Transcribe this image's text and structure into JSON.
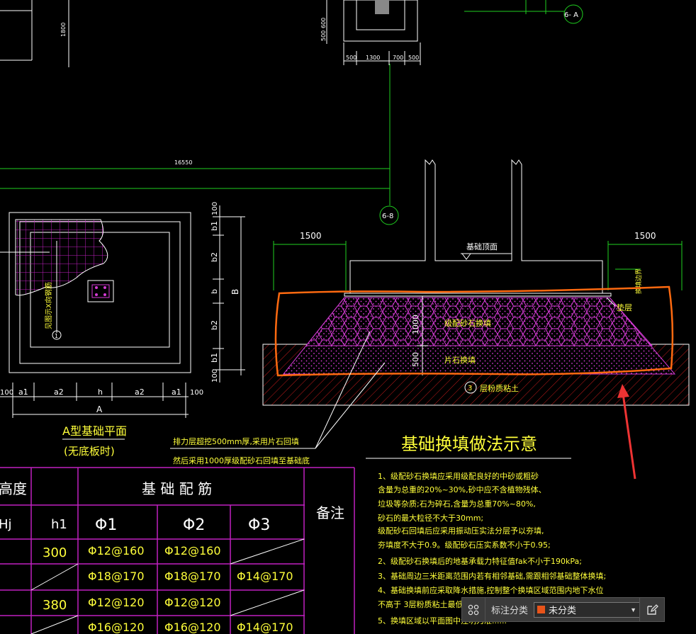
{
  "drawing": {
    "grid_labels": {
      "axis_6a": "6- A",
      "axis_6b": "6-8"
    },
    "dims_top": [
      "500",
      "1300",
      "700",
      "500"
    ],
    "dims_top_vertical": [
      "500",
      "600",
      "1800"
    ],
    "dim_long": "16550",
    "plan": {
      "title": "A型基础平面",
      "subtitle": "(无底板时)",
      "label_vert": "见图示X向钢筋",
      "label_num": "1",
      "dims_bottom": [
        "100",
        "a1",
        "a2",
        "h",
        "a2",
        "a1",
        "100"
      ],
      "dim_bottom_total": "A",
      "dims_right": [
        "100",
        "b1",
        "b2",
        "b",
        "b2",
        "b1",
        "100"
      ],
      "dim_right_total": "B"
    },
    "section": {
      "dim_left": "1500",
      "dim_right": "1500",
      "label_top": "基础顶面",
      "label_gravel": "级配砂石换填",
      "label_rubble": "片石换填",
      "label_cushion": "垫层",
      "label_soil_circle": "3",
      "label_soil": "层粉质粘土",
      "label_side": "换填边界",
      "dim_1000": "1000",
      "dim_500": "500",
      "title": "基础换填做法示意"
    },
    "note_1": "排力层超挖500mm厚,采用片石回填",
    "note_2": "然后采用1000厚级配砂石回填至基础底",
    "spec_lines": [
      "1、级配砂石换填应采用级配良好的中砂或粗砂",
      "含量为总重的20%~30%,砂中应不含植物残体、",
      "垃圾等杂质;石为碎石,含量为总重70%~80%,",
      "砂石的最大粒径不大于30mm;",
      "级配砂石回填后应采用振动压实法分层予以夯填,",
      "夯填度不大于0.9。级配砂石压实系数不小于0.95;",
      "2、级配砂石换填后的地基承载力特征值fak不小于190kPa;",
      "3、基础周边三米距离范围内若有相邻基础,需跟相邻基础整体换填;",
      "4、基础换填前应采取降水措施,控制整个换填区域范围内地下水位",
      "不高于 3层粉质粘土最低...",
      "5、换填区域以平面图中注明为准......"
    ],
    "table": {
      "header_col0": "高度",
      "header_group": "基 础 配 筋",
      "header_note": "备注",
      "sub_headers": [
        "Hj",
        "h1",
        "Φ1",
        "Φ2",
        "Φ3"
      ],
      "rows": [
        {
          "h1": "300",
          "c1": "Φ12@160",
          "c2": "Φ12@160",
          "c3": ""
        },
        {
          "h1": "",
          "c1": "Φ18@170",
          "c2": "Φ18@170",
          "c3": "Φ14@170"
        },
        {
          "h1": "380",
          "c1": "Φ12@120",
          "c2": "Φ12@120",
          "c3": ""
        },
        {
          "h1": "",
          "c1": "Φ16@120",
          "c2": "Φ16@120",
          "c3": "Φ14@170"
        }
      ]
    }
  },
  "toolbar": {
    "grid_icon": "grid-icon",
    "label": "标注分类",
    "select_value": "未分类",
    "select_color": "#e8541a",
    "edit_icon": "edit-icon"
  }
}
